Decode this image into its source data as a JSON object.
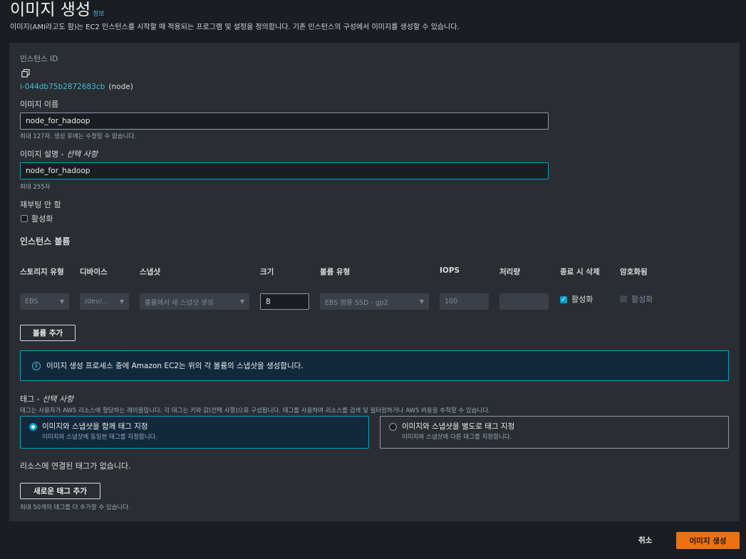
{
  "header": {
    "title": "이미지 생성",
    "info_link": "정보",
    "description": "이미지(AMI라고도 함)는 EC2 인스턴스를 시작할 때 적용되는 프로그램 및 설정을 정의합니다. 기존 인스턴스의 구성에서 이미지를 생성할 수 있습니다."
  },
  "instance": {
    "label": "인스턴스 ID",
    "id": "i-044db75b2872683cb",
    "name": "(node)"
  },
  "image_name": {
    "label": "이미지 이름",
    "value": "node_for_hadoop",
    "hint": "최대 127자. 생성 후에는 수정할 수 없습니다."
  },
  "image_description": {
    "label_main": "이미지 설명 - ",
    "label_optional": "선택 사항",
    "value": "node_for_hadoop",
    "hint": "최대 255자"
  },
  "no_reboot": {
    "label": "재부팅 안 함",
    "checkbox_label": "활성화",
    "checked": false
  },
  "volumes": {
    "section_title": "인스턴스 볼륨",
    "columns": [
      "스토리지 유형",
      "디바이스",
      "스냅샷",
      "크기",
      "볼륨 유형",
      "IOPS",
      "처리량",
      "종료 시 삭제",
      "암호화됨"
    ],
    "row": {
      "storage_type": "EBS",
      "device": "/dev/…",
      "snapshot": "볼륨에서 새 스냅샷 생성",
      "size": "8",
      "volume_type": "EBS 범용 SSD - gp2",
      "iops": "100",
      "throughput": "",
      "delete_on_termination": "활성화",
      "encrypted": "활성화"
    },
    "add_button": "볼륨 추가"
  },
  "alert": {
    "icon": "info-icon",
    "text": "이미지 생성 프로세스 중에 Amazon EC2는 위의 각 볼륨의 스냅샷을 생성합니다."
  },
  "tags": {
    "label_main": "태그 - ",
    "label_optional": "선택 사항",
    "description": "태그는 사용자가 AWS 리소스에 할당하는 레이블입니다. 각 태그는 키와 값(선택 사항)으로 구성됩니다. 태그를 사용하여 리소스를 검색 및 필터링하거나 AWS 비용을 추적할 수 있습니다.",
    "option_together": {
      "title": "이미지와 스냅샷을 함께 태그 지정",
      "subtitle": "이미지와 스냅샷에 동일한 태그를 지정합니다.",
      "selected": true
    },
    "option_separate": {
      "title": "이미지와 스냅샷을 별도로 태그 지정",
      "subtitle": "이미지와 스냅샷에 다른 태그를 지정합니다.",
      "selected": false
    },
    "empty_text": "리소스에 연결된 태그가 없습니다.",
    "add_button": "새로운 태그 추가",
    "limit_hint": "최대 50개의 태그를 더 추가할 수 있습니다."
  },
  "footer": {
    "cancel": "취소",
    "create": "이미지 생성"
  },
  "colors": {
    "accent": "#00a1c9",
    "primary_button": "#ec7211",
    "link": "#44b9d6",
    "background": "#1a1d22",
    "panel": "#2a2e33"
  }
}
